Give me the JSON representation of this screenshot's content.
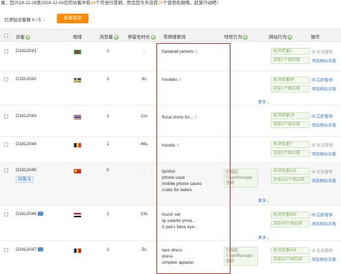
{
  "notice": {
    "prefix": "录，您2018-11-28至2018-12-04日的访客中有",
    "count_a": "66",
    "mid": "个可进行营销，而且您今天还有",
    "count_b": "20",
    "suffix": "个营销名额哦，赶紧行动吧！"
  },
  "toolbar": {
    "selected_label": "已添加访客数 0 / 5",
    "chev": "⌄",
    "bulk_button": "批量营销"
  },
  "columns": {
    "visitor": "访客",
    "region": "地域",
    "views": "浏览量",
    "stay": "停留总时长",
    "keywords": "常用搜索词",
    "wangwang": "旺旺行为",
    "site_behavior": "网站行为",
    "action": "操作"
  },
  "sort_glyph": "◆",
  "search_glyph": "⚲",
  "rows": [
    {
      "id": "D1812041",
      "views": "1",
      "stay": "-",
      "keywords": [
        "baseball jackets"
      ],
      "stats": [
        "总浏览量2",
        "浏览1个供应商"
      ],
      "actions": [
        {
          "label": "无法营销",
          "icon": "⊘",
          "style": "gray"
        },
        {
          "label": "添加相似访客",
          "icon": "",
          "style": "blue"
        }
      ]
    },
    {
      "id": "D1812042",
      "views": "1",
      "stay": "6s",
      "keywords": [
        "hoodies"
      ],
      "stats": [
        "总浏览量36",
        "浏览1个供应商"
      ],
      "more": "更多⌄",
      "actions": [
        {
          "label": "立即营销",
          "icon": "✉",
          "style": "blue"
        },
        {
          "label": "添加相似访客",
          "icon": "",
          "style": "blue"
        }
      ]
    },
    {
      "id": "D1812043",
      "views": "1",
      "stay": "11s",
      "keywords": [
        "floral shirts for..."
      ],
      "stats": [
        "总浏览量29",
        "浏览4个供应商"
      ],
      "actions": [
        {
          "label": "立即营销",
          "icon": "✉",
          "style": "blue"
        },
        {
          "label": "添加相似访客",
          "icon": "",
          "style": "blue"
        }
      ]
    },
    {
      "id": "D1812044",
      "views": "1",
      "stay": "46s",
      "keywords": [
        "hoodie"
      ],
      "stats": [
        "总浏览量7",
        "浏览3个供应商"
      ],
      "actions": [
        {
          "label": "无法营销",
          "icon": "⊘",
          "style": "gray"
        },
        {
          "label": "添加相似访客",
          "icon": "",
          "style": "blue"
        }
      ]
    },
    {
      "id": "D1812045",
      "remark": "加备注",
      "views": "0",
      "stay": "-",
      "keywords": [
        "lipstick",
        "phone case",
        "mobile phone cases",
        "coats for ladies"
      ],
      "wang": [
        "已发起",
        "TradeManager",
        "咨询"
      ],
      "stats": [
        "总浏览量103",
        "浏览412个供应商"
      ],
      "more": "更多⌄",
      "actions": [
        {
          "label": "无法营销",
          "icon": "⊘",
          "style": "gray"
        },
        {
          "label": "添加相似访客",
          "icon": "",
          "style": "blue"
        }
      ]
    },
    {
      "id": "D1812046",
      "views": "1",
      "stay": "33s",
      "keywords": [
        "brush set",
        "lip palette priva...",
        "5 pairs false eye..."
      ],
      "stats": [
        "总浏览量590",
        "浏览49个供应商"
      ],
      "more": "更多⌄",
      "actions": [
        {
          "label": "立即营销",
          "icon": "✉",
          "style": "blue"
        },
        {
          "label": "添加相似访客",
          "icon": "",
          "style": "blue"
        }
      ]
    },
    {
      "id": "D1812047",
      "views": "1",
      "stay": "5s",
      "keywords": [
        "lace dress",
        "dress",
        "simplee apparel"
      ],
      "wang": [
        "已发起",
        "TradeManager",
        "咨询"
      ],
      "stats": [
        "总浏览量434",
        "浏览22个供应商"
      ],
      "actions": [
        {
          "label": "无法营销",
          "icon": "⊘",
          "style": "gray"
        },
        {
          "label": "添加相似访客",
          "icon": "",
          "style": "blue"
        }
      ]
    }
  ]
}
